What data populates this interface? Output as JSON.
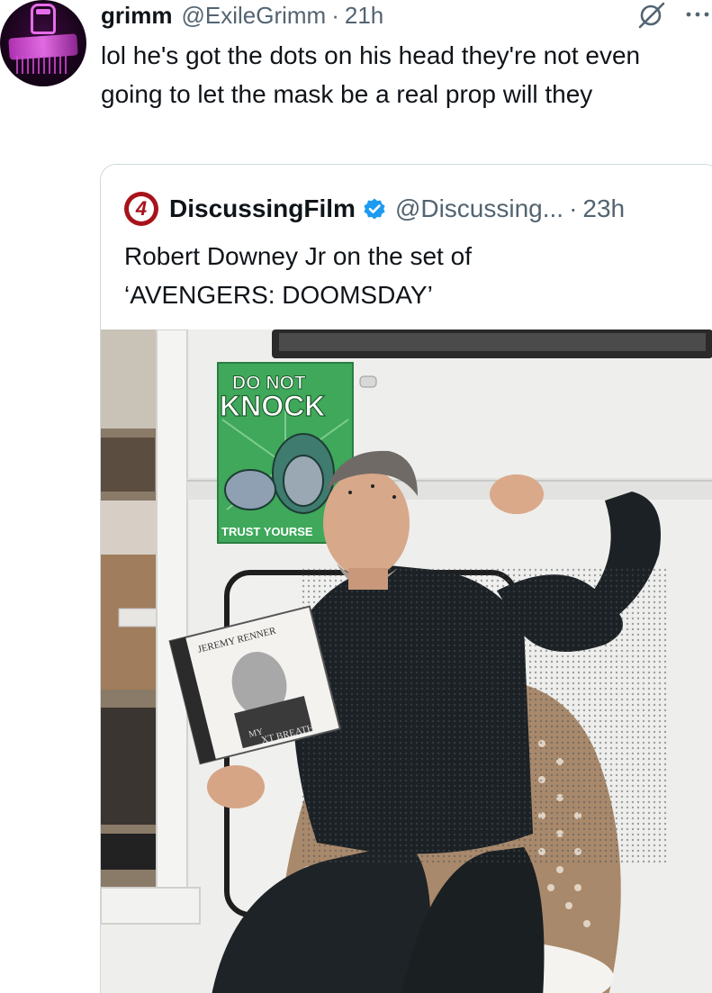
{
  "tweet": {
    "display_name": "grimm",
    "handle": "@ExileGrimm",
    "separator": "·",
    "time": "21h",
    "text": "lol he's got the dots on his head they're not even going to let the mask be a real prop will they",
    "icons": {
      "grok": "grok-icon",
      "more": "more-dots-icon"
    }
  },
  "quote": {
    "logo_text": "4",
    "display_name": "DiscussingFilm",
    "verified": true,
    "handle": "@Discussing...",
    "separator": "·",
    "time": "23h",
    "text_line1": "Robert Downey Jr on the set of",
    "text_line2": "‘AVENGERS: DOOMSDAY’",
    "photo": {
      "poster_line1": "DO NOT",
      "poster_line2": "KNOCK",
      "poster_footer": "TRUST YOURSE",
      "book_author": "JEREMY RENNER",
      "book_title_1": "MY",
      "book_title_2": "XT BREATH"
    }
  },
  "colors": {
    "text": "#0f1419",
    "secondary": "#536471",
    "border": "#cfd9de",
    "verified": "#1d9bf0",
    "brand_red": "#a8121b"
  }
}
